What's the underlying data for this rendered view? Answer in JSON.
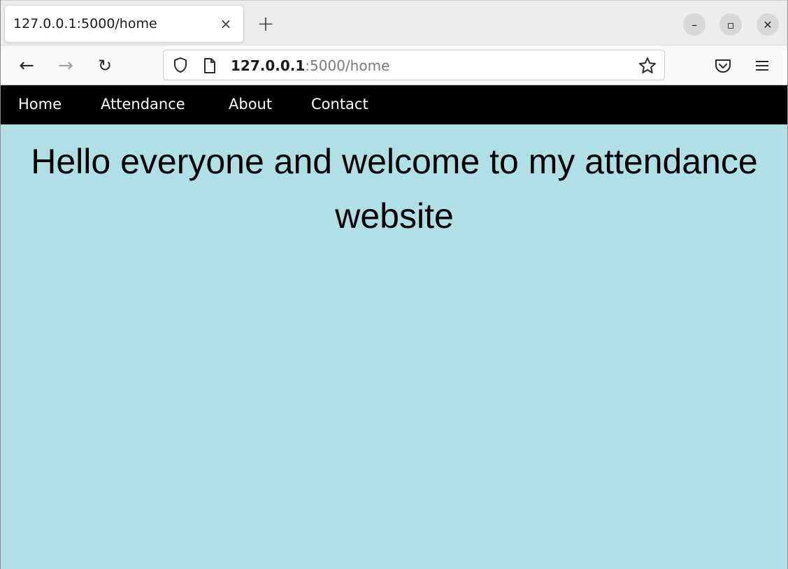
{
  "browser": {
    "tab": {
      "title": "127.0.0.1:5000/home",
      "close_label": "×"
    },
    "new_tab_label": "+",
    "window_controls": {
      "minimize": "–",
      "maximize": "▫",
      "close": "✕"
    },
    "toolbar": {
      "back_icon": "←",
      "forward_icon": "→",
      "reload_icon": "↻",
      "url_host": "127.0.0.1",
      "url_rest": ":5000/home"
    }
  },
  "navbar": {
    "items": [
      {
        "label": "Home"
      },
      {
        "label": "Attendance"
      },
      {
        "label": "About"
      },
      {
        "label": "Contact"
      }
    ]
  },
  "main": {
    "heading": "Hello everyone and welcome to my attendance website"
  },
  "colors": {
    "page_background": "#b0dfe5",
    "navbar_background": "#000000",
    "navbar_text": "#ffffff"
  }
}
